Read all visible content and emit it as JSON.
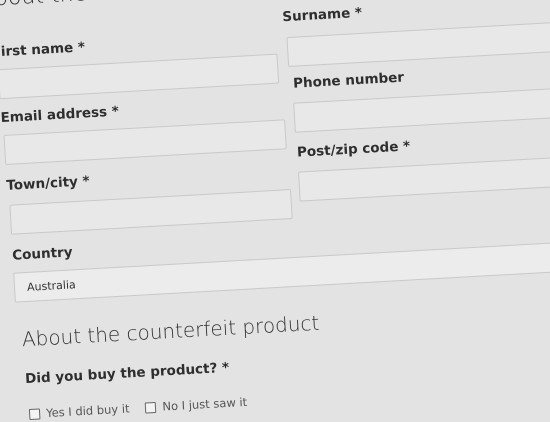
{
  "form": {
    "heading_partial": "bout the",
    "labels": {
      "first_name": "irst name *",
      "surname": "Surname *",
      "email": "Email address *",
      "phone": "Phone number",
      "town": "Town/city *",
      "postcode": "Post/zip code *",
      "country": "Country"
    },
    "country_value": "Australia"
  },
  "product_section": {
    "title": "About the counterfeit product",
    "question": "Did you buy the product? *",
    "options": [
      "Yes I did buy it",
      "No I just saw it"
    ]
  }
}
